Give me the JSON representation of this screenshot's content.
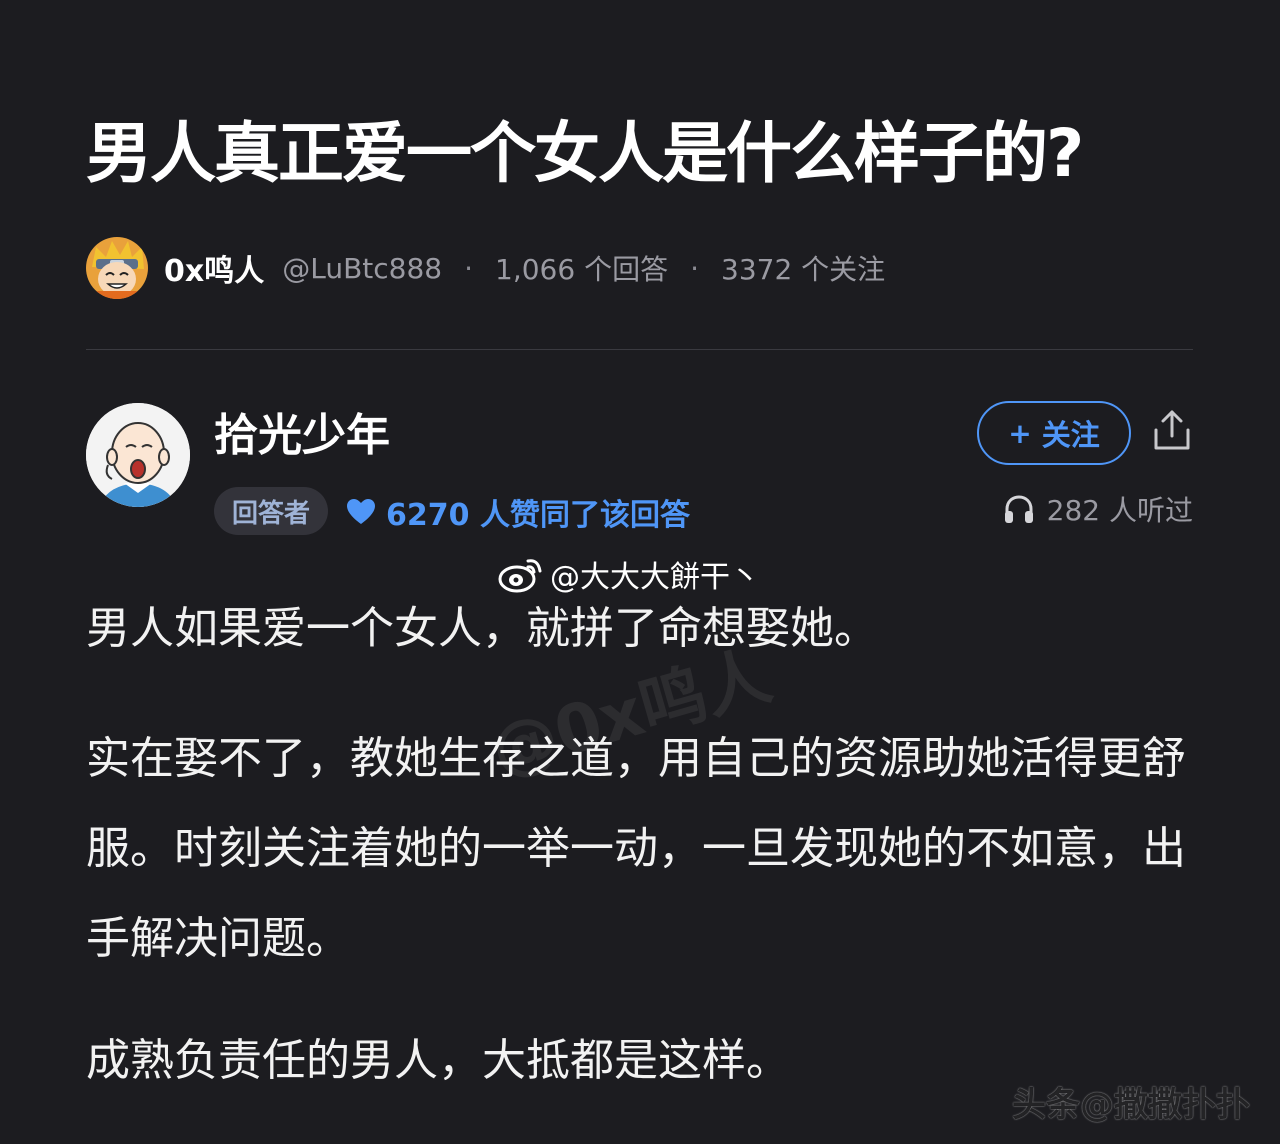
{
  "question": {
    "title": "男人真正爱一个女人是什么样子的?"
  },
  "asker": {
    "name": "0x鸣人",
    "handle": "@LuBtc888",
    "separator": "·",
    "answers_count": "1,066 个回答",
    "followers_count": "3372 个关注"
  },
  "answer": {
    "author_name": "拾光少年",
    "role_badge": "回答者",
    "likes": "6270 人赞同了该回答",
    "follow_button": "关注",
    "follow_plus": "+",
    "listens": "282 人听过",
    "paragraphs": [
      "男人如果爱一个女人，就拼了命想娶她。",
      "实在娶不了，教她生存之道，用自己的资源助她活得更舒服。时刻关注着她的一举一动，一旦发现她的不如意，出手解决问题。",
      "成熟负责任的男人，大抵都是这样。"
    ]
  },
  "watermarks": {
    "weibo": "@大大大餅干丶",
    "diagonal": "@0x鸣人",
    "corner": "头条@撒撒扑扑"
  },
  "icons": {
    "asker_avatar": "cartoon-avatar-icon",
    "answerer_avatar": "bald-cartoon-avatar-icon",
    "likes": "heart-icon",
    "share": "share-icon",
    "listens": "headphones-icon",
    "weibo": "weibo-icon"
  },
  "colors": {
    "background": "#1c1c20",
    "accent": "#4f96f7",
    "muted": "#9a9aa2"
  }
}
